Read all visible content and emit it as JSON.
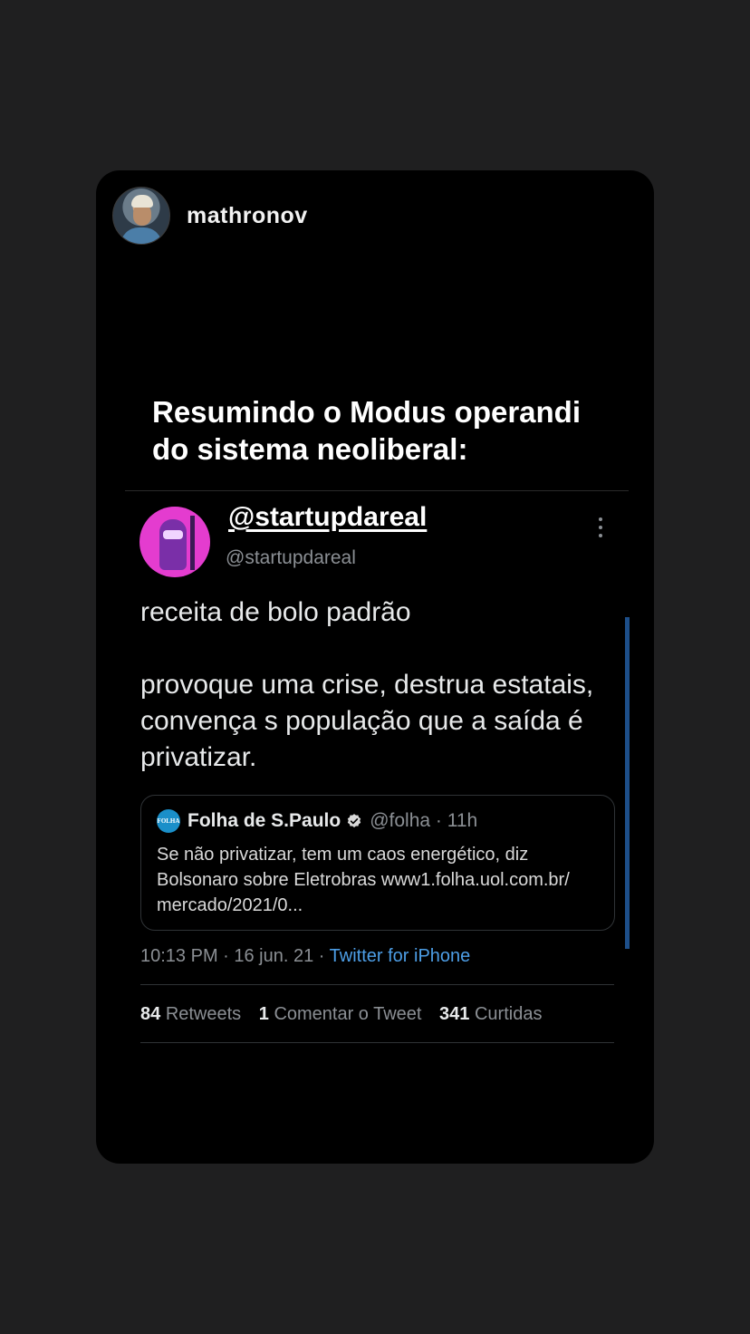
{
  "story": {
    "username": "mathronov",
    "caption": "Resumindo o Modus operandi do sistema neoliberal:"
  },
  "tweet": {
    "display_name": "@startupdareal",
    "handle": "@startupdareal",
    "text_line1": "receita de bolo padrão",
    "text_line2": "provoque uma crise, destrua estatais, convença s população que a saída é privatizar.",
    "quote": {
      "logo_text": "FOLHA",
      "name": "Folha de S.Paulo",
      "meta": "@folha · 11h",
      "text": "Se não privatizar, tem um caos energético, diz Bolsonaro sobre Eletrobras www1.folha.uol.com.br/ mercado/2021/0..."
    },
    "timestamp": "10:13 PM · 16 jun. 21 · ",
    "source": "Twitter for iPhone",
    "stats": {
      "retweets_count": "84",
      "retweets_label": "Retweets",
      "comments_count": "1",
      "comments_label": "Comentar o Tweet",
      "likes_count": "341",
      "likes_label": "Curtidas"
    }
  },
  "colors": {
    "background": "#1f1f20",
    "card": "#000000",
    "link": "#4d9ee6",
    "thread_line": "#1d4f8a",
    "avatar_accent": "#e43ccf"
  },
  "icons": [
    "avatar",
    "more-vertical-icon",
    "folha-logo-icon",
    "verified-badge-icon"
  ]
}
